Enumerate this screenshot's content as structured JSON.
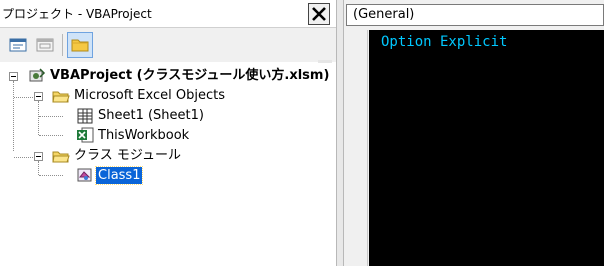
{
  "project_explorer": {
    "title": "プロジェクト - VBAProject",
    "toolbar": {
      "view_code": "view-code-icon",
      "view_object": "view-object-icon",
      "toggle_folders": "folder-icon"
    },
    "tree": {
      "root": {
        "label": "VBAProject (クラスモジュール使い方.xlsm)",
        "icon": "vba-project-icon"
      },
      "folders": [
        {
          "label": "Microsoft Excel Objects",
          "items": [
            {
              "label": "Sheet1 (Sheet1)",
              "icon": "worksheet-icon"
            },
            {
              "label": "ThisWorkbook",
              "icon": "excel-workbook-icon"
            }
          ]
        },
        {
          "label": "クラス モジュール",
          "items": [
            {
              "label": "Class1",
              "icon": "class-module-icon",
              "selected": true
            }
          ]
        }
      ]
    }
  },
  "code_window": {
    "object_dropdown": "(General)",
    "lines": [
      "Option Explicit"
    ],
    "colors": {
      "background": "#000000",
      "text": "#00c8ff"
    }
  }
}
